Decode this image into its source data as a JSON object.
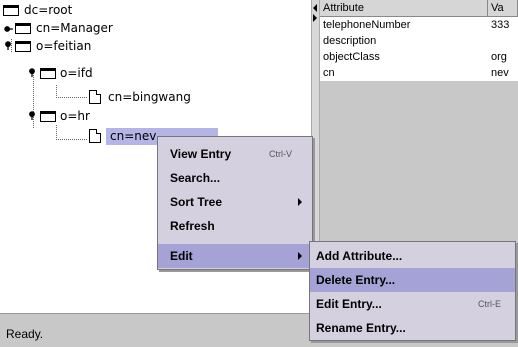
{
  "tree": {
    "nodes": [
      {
        "label": "dc=root"
      },
      {
        "label": "cn=Manager"
      },
      {
        "label": "o=feitian"
      },
      {
        "label": "o=ifd"
      },
      {
        "label": "cn=bingwang"
      },
      {
        "label": "o=hr"
      },
      {
        "label": "cn=nev"
      }
    ]
  },
  "table": {
    "headers": [
      "Attribute",
      "Va"
    ],
    "rows": [
      {
        "attr": "telephoneNumber",
        "val": "333"
      },
      {
        "attr": "description",
        "val": ""
      },
      {
        "attr": "objectClass",
        "val": "org"
      },
      {
        "attr": "cn",
        "val": "nev"
      }
    ]
  },
  "context_menu": {
    "items": [
      {
        "label": "View Entry",
        "shortcut": "Ctrl-V"
      },
      {
        "label": "Search..."
      },
      {
        "label": "Sort Tree"
      },
      {
        "label": "Refresh"
      },
      {
        "label": "Edit"
      }
    ]
  },
  "edit_submenu": {
    "items": [
      {
        "label": "Add Attribute..."
      },
      {
        "label": "Delete Entry..."
      },
      {
        "label": "Edit Entry...",
        "shortcut": "Ctrl-E"
      },
      {
        "label": "Rename Entry..."
      }
    ]
  },
  "status": {
    "text": "Ready."
  },
  "colors": {
    "menu_bg": "#d4d0e0",
    "highlight": "#a5a3d6",
    "selection": "#b4b4e6"
  }
}
